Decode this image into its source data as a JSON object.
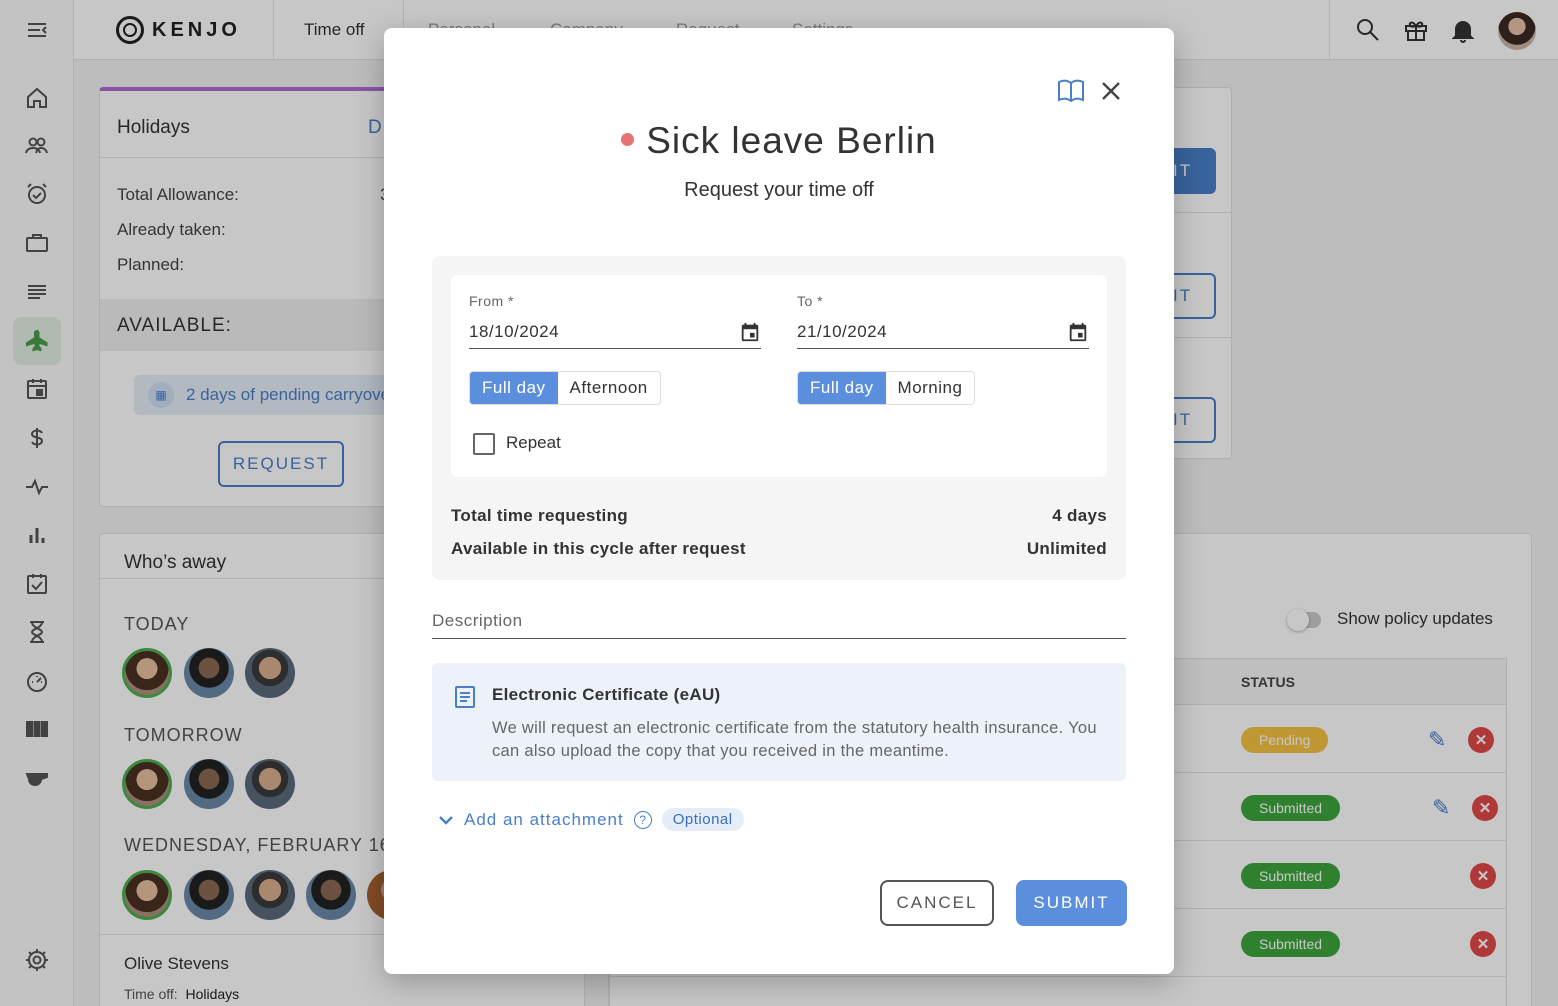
{
  "topbar": {
    "brand": "KENJO",
    "tabs": [
      "Time off",
      "Personal",
      "Company",
      "Request",
      "Settings"
    ]
  },
  "holidays_card": {
    "title": "Holidays",
    "detail_link": "D",
    "total_allowance_label": "Total Allowance:",
    "total_allowance_value": "3",
    "already_taken_label": "Already taken:",
    "planned_label": "Planned:",
    "available_label": "AVAILABLE:",
    "pending_carryover": "2 days of pending carryover",
    "request_button": "REQUEST"
  },
  "whos_away": {
    "title": "Who’s away",
    "days": [
      {
        "label": "TODAY"
      },
      {
        "label": "TOMORROW"
      },
      {
        "label": "WEDNESDAY, FEBRUARY 16"
      }
    ],
    "person_name": "Olive Stevens",
    "person_timeoff_label": "Time off:",
    "person_timeoff_value": "Holidays"
  },
  "right_card": {
    "button_text": "IT"
  },
  "requests_table": {
    "toggle_label": "Show policy updates",
    "status_header": "STATUS",
    "rows": [
      {
        "status": "Pending",
        "editable": true
      },
      {
        "status": "Submitted",
        "editable": true
      },
      {
        "status": "Submitted",
        "editable": false
      },
      {
        "status": "Submitted",
        "editable": false
      }
    ]
  },
  "modal": {
    "title": "Sick leave Berlin",
    "subtitle": "Request your time off",
    "from_label": "From *",
    "from_value": "18/10/2024",
    "to_label": "To *",
    "to_value": "21/10/2024",
    "from_options": [
      "Full day",
      "Afternoon"
    ],
    "to_options": [
      "Full day",
      "Morning"
    ],
    "repeat_label": "Repeat",
    "total_label": "Total time requesting",
    "total_value": "4 days",
    "available_label": "Available in this cycle after request",
    "available_value": "Unlimited",
    "description_placeholder": "Description",
    "info_title": "Electronic Certificate (eAU)",
    "info_text": "We will request an electronic certificate from the statutory health insurance. You can also upload the copy that you received in the meantime.",
    "attachment_label": "Add an attachment",
    "attachment_badge": "Optional",
    "cancel_button": "CANCEL",
    "submit_button": "SUBMIT",
    "dot_color": "#e57373",
    "accent_color": "#5b8fdd"
  }
}
